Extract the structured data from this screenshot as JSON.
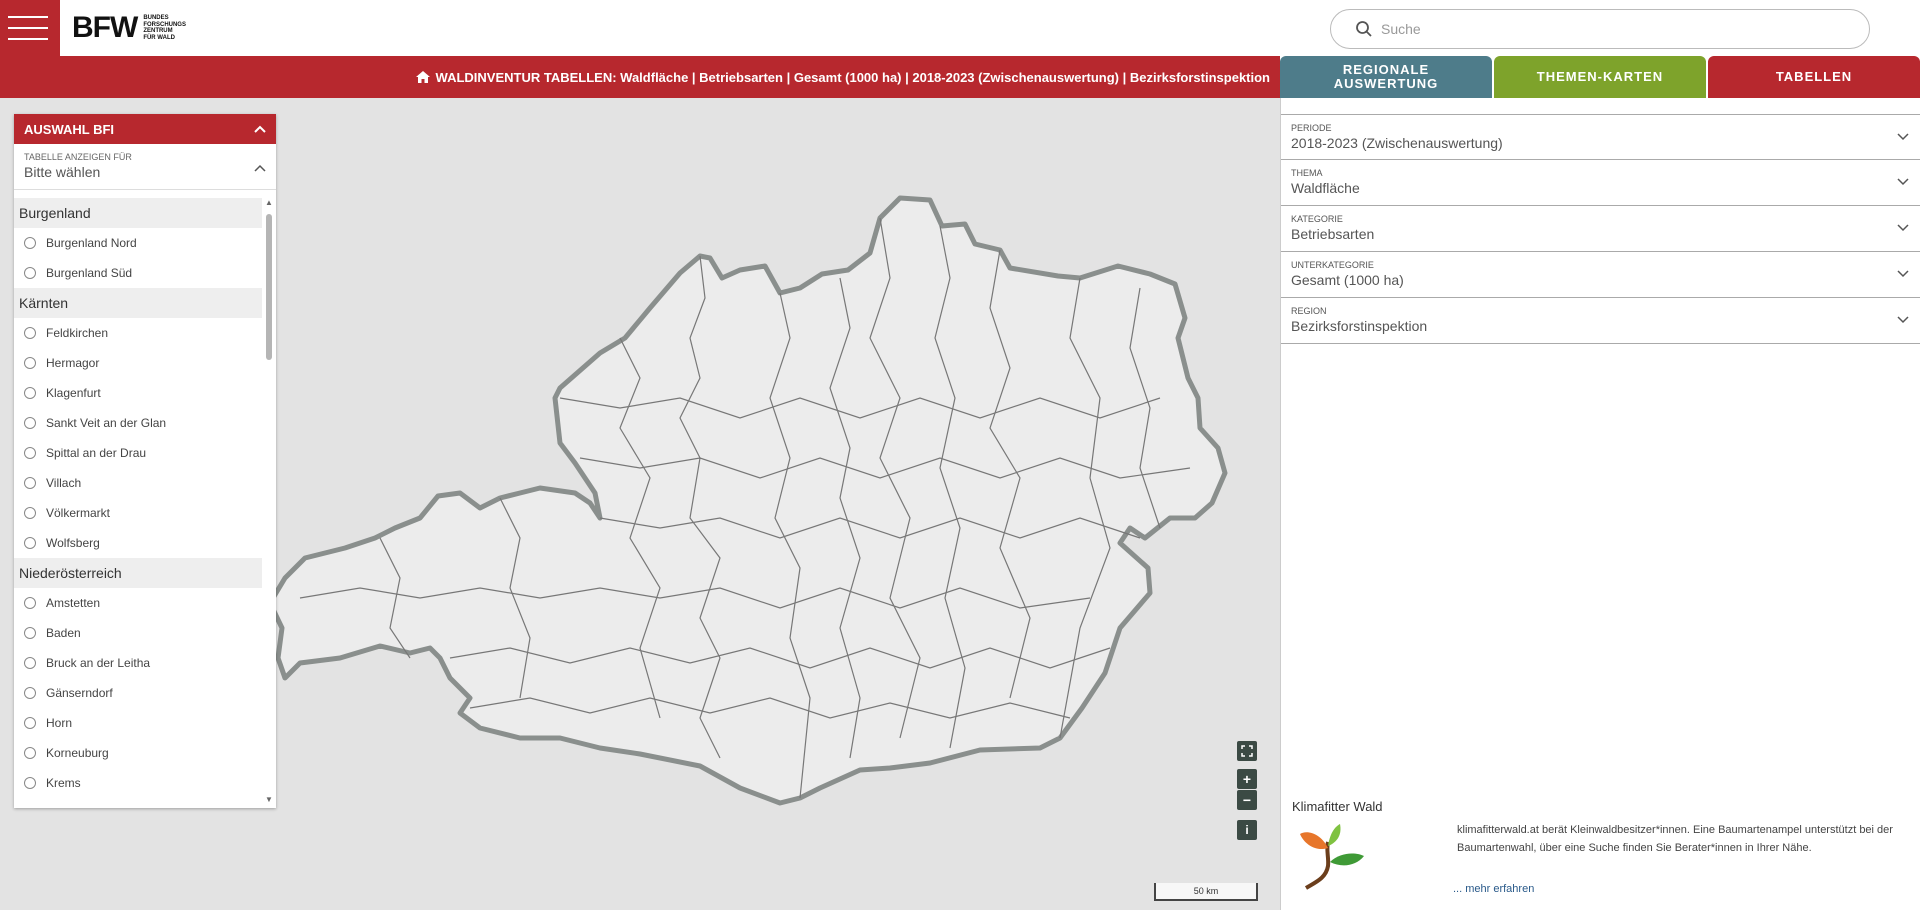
{
  "header": {
    "logo_text": "BFW",
    "logo_sub": [
      "BUNDES",
      "FORSCHUNGS",
      "ZENTRUM",
      "FÜR WALD"
    ],
    "search_placeholder": "Suche"
  },
  "titlebar": {
    "text": "WALDINVENTUR TABELLEN: Waldfläche | Betriebsarten | Gesamt (1000 ha) | 2018-2023 (Zwischenauswertung) | Bezirksforstinspektion"
  },
  "tabs": [
    {
      "label": "REGIONALE AUSWERTUNG",
      "color": "#4e7c8a"
    },
    {
      "label": "THEMEN-KARTEN",
      "color": "#7ea32b"
    },
    {
      "label": "TABELLEN",
      "color": "#b7282e"
    }
  ],
  "panel": {
    "title": "AUSWAHL BFI",
    "select_label": "TABELLE ANZEIGEN FÜR",
    "select_value": "Bitte wählen",
    "groups": [
      {
        "name": "Burgenland",
        "items": [
          "Burgenland Nord",
          "Burgenland Süd"
        ]
      },
      {
        "name": "Kärnten",
        "items": [
          "Feldkirchen",
          "Hermagor",
          "Klagenfurt",
          "Sankt Veit an der Glan",
          "Spittal an der Drau",
          "Villach",
          "Völkermarkt",
          "Wolfsberg"
        ]
      },
      {
        "name": "Niederösterreich",
        "items": [
          "Amstetten",
          "Baden",
          "Bruck an der Leitha",
          "Gänserndorf",
          "Horn",
          "Korneuburg",
          "Krems"
        ]
      }
    ]
  },
  "filters": [
    {
      "label": "PERIODE",
      "value": "2018-2023 (Zwischenauswertung)"
    },
    {
      "label": "THEMA",
      "value": "Waldfläche"
    },
    {
      "label": "KATEGORIE",
      "value": "Betriebsarten"
    },
    {
      "label": "UNTERKATEGORIE",
      "value": "Gesamt (1000 ha)"
    },
    {
      "label": "REGION",
      "value": "Bezirksforstinspektion"
    }
  ],
  "map_controls": {
    "fullscreen": "⛶",
    "zoom_in": "+",
    "zoom_out": "−",
    "info": "i"
  },
  "scale": "50 km",
  "promo": {
    "title": "Klimafitter Wald",
    "text": "klimafitterwald.at berät Kleinwaldbesitzer*innen. Eine Baumartenampel unterstützt bei der Baumartenwahl, über eine Suche finden Sie Berater*innen in Ihrer Nähe.",
    "link": "... mehr erfahren"
  },
  "colors": {
    "brand_red": "#b7282e",
    "teal": "#4e7c8a",
    "green": "#7ea32b"
  }
}
